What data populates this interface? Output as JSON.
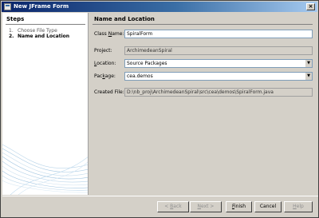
{
  "window": {
    "title": "New JFrame Form",
    "close_glyph": "×"
  },
  "steps": {
    "heading": "Steps",
    "items": [
      {
        "num": "1.",
        "label": "Choose File Type"
      },
      {
        "num": "2.",
        "label": "Name and Location"
      }
    ]
  },
  "content": {
    "title": "Name and Location",
    "class_name": {
      "label_pre": "Class ",
      "label_mn": "N",
      "label_post": "ame:",
      "value": "SpiralForm"
    },
    "project": {
      "label": "Project:",
      "value": "ArchimedeanSpiral"
    },
    "location": {
      "label_pre": "",
      "label_mn": "L",
      "label_post": "ocation:",
      "value": "Source Packages"
    },
    "package": {
      "label_pre": "Pac",
      "label_mn": "k",
      "label_post": "age:",
      "value": "cea.demos"
    },
    "created_file": {
      "label": "Created File:",
      "value": "D:\\nb_proj\\ArchimedeanSpiral\\src\\cea\\demos\\SpiralForm.java"
    }
  },
  "buttons": {
    "back": {
      "pre": "< ",
      "mn": "B",
      "post": "ack"
    },
    "next": {
      "pre": "",
      "mn": "N",
      "post": "ext >"
    },
    "finish": {
      "pre": "",
      "mn": "F",
      "post": "inish"
    },
    "cancel": {
      "label": "Cancel"
    },
    "help": {
      "pre": "",
      "mn": "H",
      "post": "elp"
    }
  },
  "icons": {
    "combo_arrow": "▼"
  },
  "colors": {
    "titlebar_start": "#0a246a",
    "titlebar_end": "#a6caf0",
    "dialog_bg": "#d4d0c8",
    "field_border": "#7f9db9"
  }
}
